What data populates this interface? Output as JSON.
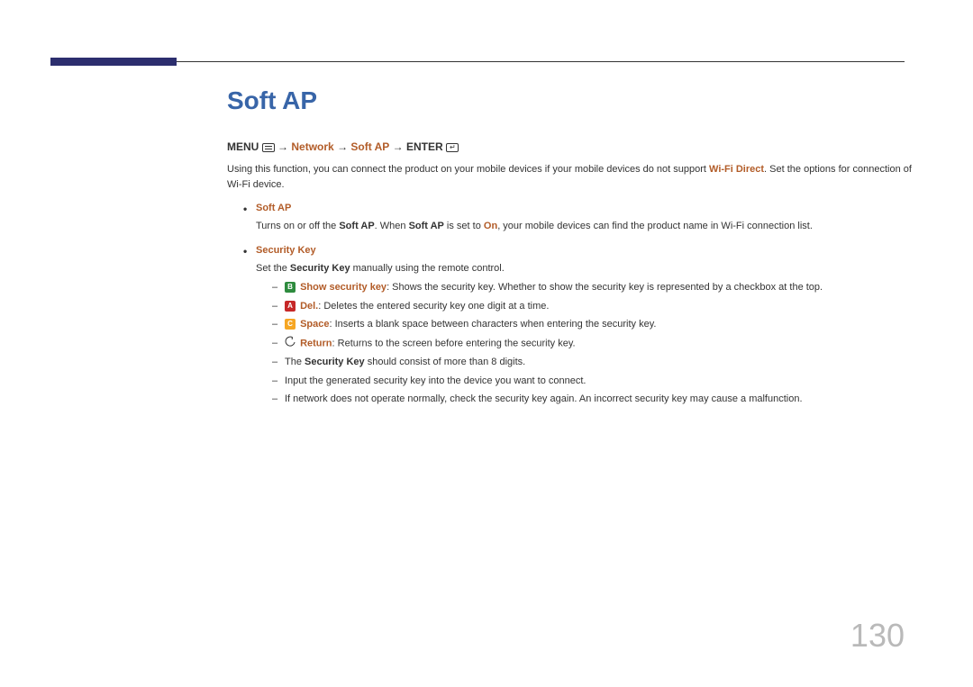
{
  "title": "Soft AP",
  "breadcrumb": {
    "menu": "MENU",
    "network": "Network",
    "softap": "Soft AP",
    "enter": "ENTER",
    "arrow": "→"
  },
  "intro": {
    "pre": "Using this function, you can connect the product on your mobile devices if your mobile devices do not support ",
    "wifidirect": "Wi-Fi Direct",
    "post": ". Set the options for connection of Wi-Fi device."
  },
  "items": [
    {
      "title": "Soft AP",
      "body_parts": {
        "p1": "Turns on or off the ",
        "s1": "Soft AP",
        "p2": ". When ",
        "s2": "Soft AP",
        "p3": " is set to ",
        "on": "On",
        "p4": ", your mobile devices can find the product name in Wi-Fi connection list."
      }
    },
    {
      "title": "Security Key",
      "body_parts": {
        "p1": "Set the ",
        "s1": "Security Key",
        "p2": " manually using the remote control."
      },
      "sub": [
        {
          "badge": {
            "letter": "B",
            "class": "badge-green"
          },
          "label": "Show security key",
          "text": ": Shows the security key. Whether to show the security key is represented by a checkbox at the top."
        },
        {
          "badge": {
            "letter": "A",
            "class": "badge-red"
          },
          "label": "Del.",
          "text": ": Deletes the entered security key one digit at a time."
        },
        {
          "badge": {
            "letter": "C",
            "class": "badge-yellow"
          },
          "label": "Space",
          "text": ": Inserts a blank space between characters when entering the security key."
        },
        {
          "return_icon": true,
          "label": "Return",
          "text": ": Returns to the screen before entering the security key."
        },
        {
          "plain_parts": {
            "p1": "The ",
            "s1": "Security Key",
            "p2": " should consist of more than 8 digits."
          }
        },
        {
          "plain": "Input the generated security key into the device you want to connect."
        },
        {
          "plain": "If network does not operate normally, check the security key again. An incorrect security key may cause a malfunction."
        }
      ]
    }
  ],
  "page_number": "130"
}
